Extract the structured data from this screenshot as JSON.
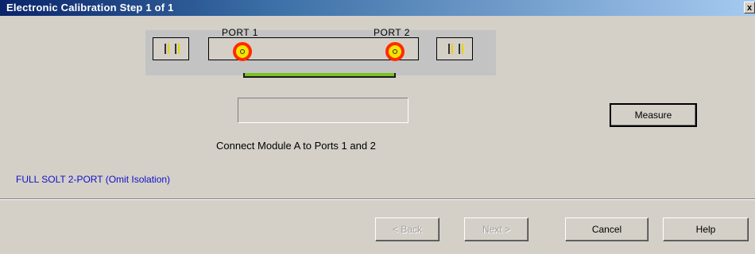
{
  "window": {
    "title": "Electronic Calibration Step 1 of 1",
    "close_label": "x"
  },
  "diagram": {
    "port1_label": "PORT 1",
    "port2_label": "PORT 2"
  },
  "status_box": {
    "value": ""
  },
  "measure_label": "Measure",
  "instruction": "Connect Module A to Ports 1 and 2",
  "cal_type": "FULL SOLT 2-PORT (Omit Isolation)",
  "buttons": {
    "back": "< Back",
    "next": "Next >",
    "cancel": "Cancel",
    "help": "Help"
  },
  "colors": {
    "title_bar": "#0a246a",
    "connector_outer": "#ff2a00",
    "connector_inner": "#f4e400",
    "cable": "#7ac21f",
    "cal_type_text": "#1010c8"
  }
}
